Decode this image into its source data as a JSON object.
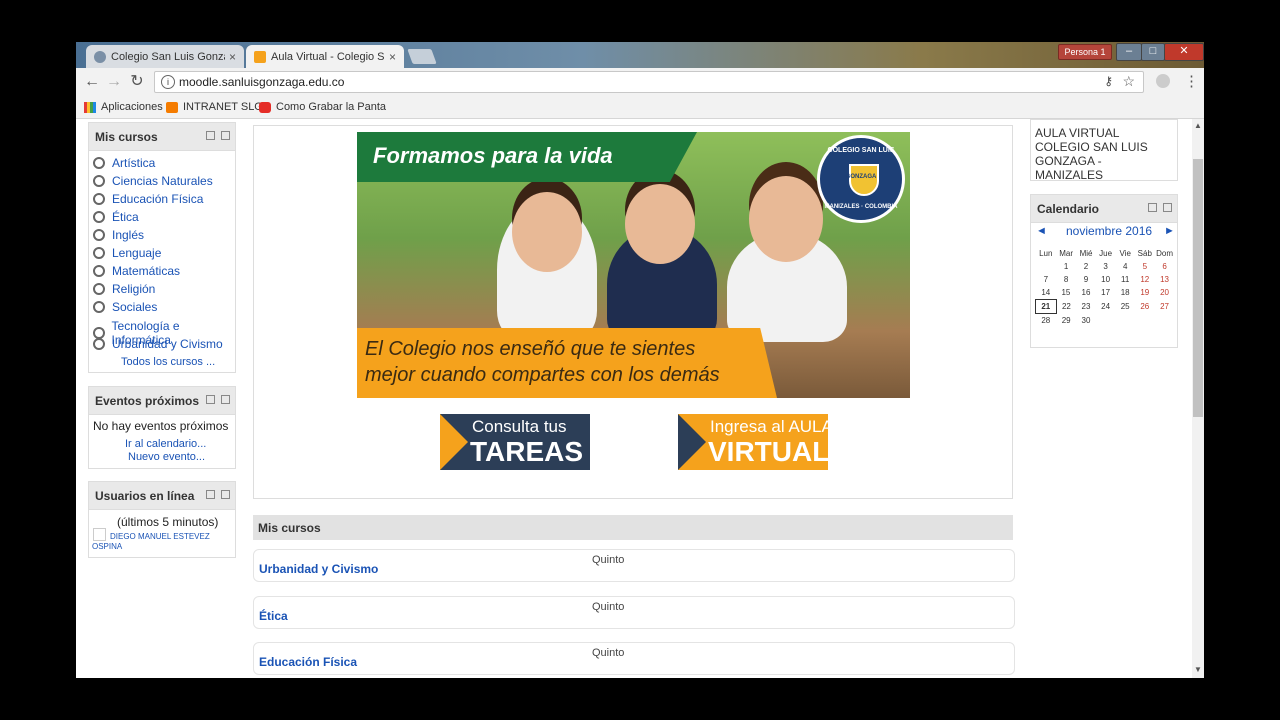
{
  "browser": {
    "tabs": [
      {
        "title": "Colegio San Luis Gonzaga",
        "close": "×"
      },
      {
        "title": "Aula Virtual - Colegio San",
        "close": "×"
      }
    ],
    "profile": "Persona 1",
    "url": "moodle.sanluisgonzaga.edu.co",
    "bookmarks": [
      "Aplicaciones",
      "INTRANET SLG",
      "Como Grabar la Panta"
    ]
  },
  "sidebar": {
    "my_courses": {
      "title": "Mis cursos",
      "items": [
        "Artística",
        "Ciencias Naturales",
        "Educación Física",
        "Ética",
        "Inglés",
        "Lenguaje",
        "Matemáticas",
        "Religión",
        "Sociales",
        "Tecnología e Informática",
        "Urbanidad y Civismo"
      ],
      "all_link": "Todos los cursos ..."
    },
    "events": {
      "title": "Eventos próximos",
      "empty": "No hay eventos próximos",
      "calendar_link": "Ir al calendario...",
      "new_event": "Nuevo evento..."
    },
    "online": {
      "title": "Usuarios en línea",
      "window": "(últimos 5 minutos)",
      "user": "DIEGO MANUEL ESTEVEZ OSPINA"
    }
  },
  "banner": {
    "headline": "Formamos para la vida",
    "quote_line1": "El Colegio nos enseñó que te sientes",
    "quote_line2": "mejor cuando compartes con los demás",
    "seal_top": "COLEGIO SAN LUIS",
    "seal_mid": "GONZAGA",
    "seal_bottom": "MANIZALES · COLOMBIA"
  },
  "cta": {
    "tasks_line1": "Consulta tus",
    "tasks_line2": "TAREAS",
    "aula_line1": "Ingresa al AULA",
    "aula_line2": "VIRTUAL"
  },
  "main_courses": {
    "title": "Mis cursos",
    "rows": [
      {
        "name": "Urbanidad y Civismo",
        "grade": "Quinto"
      },
      {
        "name": "Ética",
        "grade": "Quinto"
      },
      {
        "name": "Educación Física",
        "grade": "Quinto"
      }
    ]
  },
  "right": {
    "site_title": "AULA VIRTUAL COLEGIO SAN LUIS GONZAGA - MANIZALES",
    "calendar": {
      "title": "Calendario",
      "month": "noviembre 2016",
      "prev": "◄",
      "next": "►",
      "days": [
        "Lun",
        "Mar",
        "Mié",
        "Jue",
        "Vie",
        "Sáb",
        "Dom"
      ],
      "weeks": [
        [
          "",
          "1",
          "2",
          "3",
          "4",
          "5",
          "6"
        ],
        [
          "7",
          "8",
          "9",
          "10",
          "11",
          "12",
          "13"
        ],
        [
          "14",
          "15",
          "16",
          "17",
          "18",
          "19",
          "20"
        ],
        [
          "21",
          "22",
          "23",
          "24",
          "25",
          "26",
          "27"
        ],
        [
          "28",
          "29",
          "30",
          "",
          "",
          "",
          ""
        ]
      ],
      "today": "21"
    }
  }
}
